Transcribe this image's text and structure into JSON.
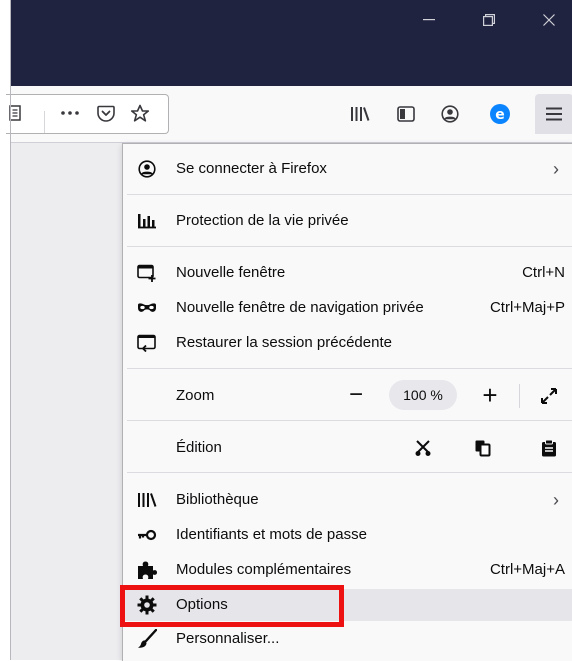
{
  "window": {
    "minimize_icon": "minimize-icon",
    "restore_icon": "restore-icon",
    "close_icon": "close-icon"
  },
  "toolbar": {
    "icons": [
      "reader-icon",
      "more-icon",
      "pocket-icon",
      "bookmark-star-icon",
      "library-icon",
      "sidebar-icon",
      "account-icon",
      "extension-icon",
      "hamburger-menu-icon"
    ]
  },
  "menu": {
    "sign_in": {
      "label": "Se connecter à Firefox",
      "chevron": "›"
    },
    "privacy": {
      "label": "Protection de la vie privée"
    },
    "new_window": {
      "label": "Nouvelle fenêtre",
      "shortcut": "Ctrl+N"
    },
    "private_window": {
      "label": "Nouvelle fenêtre de navigation privée",
      "shortcut": "Ctrl+Maj+P"
    },
    "restore_session": {
      "label": "Restaurer la session précédente"
    },
    "zoom": {
      "label": "Zoom",
      "minus": "−",
      "value": "100 %",
      "plus": "+"
    },
    "edit": {
      "label": "Édition"
    },
    "library": {
      "label": "Bibliothèque",
      "chevron": "›"
    },
    "logins": {
      "label": "Identifiants et mots de passe"
    },
    "addons": {
      "label": "Modules complémentaires",
      "shortcut": "Ctrl+Maj+A"
    },
    "options": {
      "label": "Options"
    },
    "customize": {
      "label": "Personnaliser..."
    }
  },
  "colors": {
    "titlebar": "#202340",
    "highlight": "#ee1111",
    "account_blue": "#0a84ff"
  }
}
